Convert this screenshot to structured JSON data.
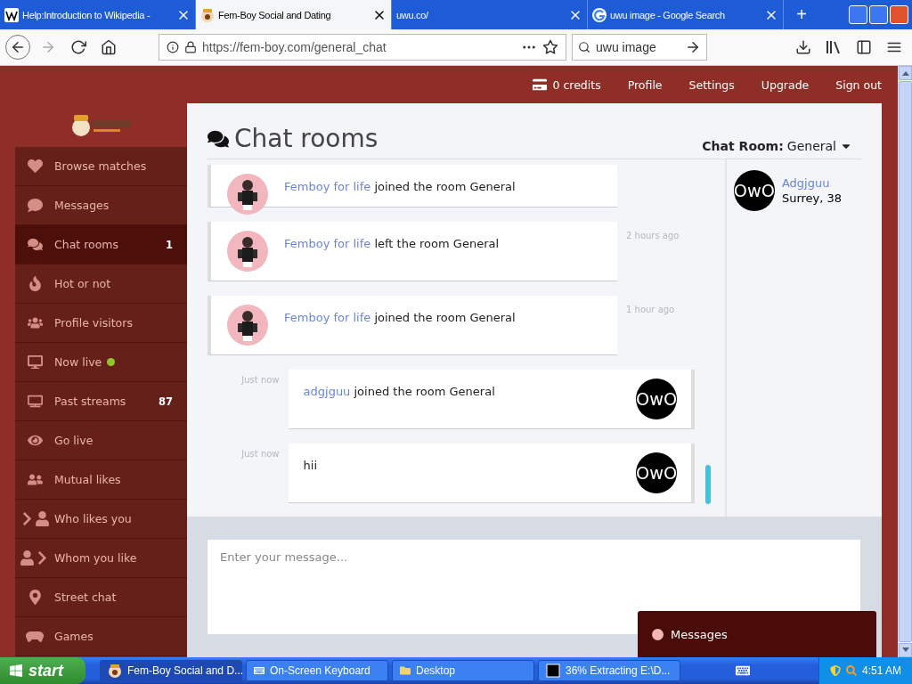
{
  "browser": {
    "tabs": [
      {
        "title": "Help:Introduction to Wikipedia -",
        "selected": false,
        "kind": "wiki"
      },
      {
        "title": "Fem-Boy Social and Dating",
        "selected": true,
        "kind": "site"
      },
      {
        "title": "uwu.co/",
        "selected": false,
        "kind": "plain"
      },
      {
        "title": "uwu image - Google Search",
        "selected": false,
        "kind": "google"
      }
    ],
    "new_tab": "+",
    "url": "https://fem-boy.com/general_chat",
    "search": "uwu image"
  },
  "top_links": [
    {
      "label": "0 credits",
      "kind": "credits"
    },
    {
      "label": "Profile",
      "kind": "link"
    },
    {
      "label": "Settings",
      "kind": "link"
    },
    {
      "label": "Upgrade",
      "kind": "link"
    },
    {
      "label": "Sign out",
      "kind": "link"
    }
  ],
  "sidebar": {
    "items": [
      {
        "label": "Browse matches",
        "selected": false
      },
      {
        "label": "Messages",
        "selected": false
      },
      {
        "label": "Chat rooms",
        "selected": true,
        "count": "1"
      },
      {
        "label": "Hot or not",
        "selected": false
      },
      {
        "label": "Profile visitors",
        "selected": false
      },
      {
        "label": "Now live",
        "selected": false,
        "live": true
      },
      {
        "label": "Past streams",
        "selected": false,
        "count": "87"
      },
      {
        "label": "Go live",
        "selected": false
      },
      {
        "label": "Mutual likes",
        "selected": false
      },
      {
        "label": "Who likes you",
        "selected": false
      },
      {
        "label": "Whom you like",
        "selected": false
      },
      {
        "label": "Street chat",
        "selected": false
      },
      {
        "label": "Games",
        "selected": false
      }
    ]
  },
  "chat": {
    "title": "Chat rooms",
    "room_label": "Chat Room:",
    "room": "General",
    "messages": [
      {
        "kind": "incoming",
        "user": "Femboy for life",
        "text": "joined the room General"
      },
      {
        "kind": "incoming",
        "user": "Femboy for life",
        "text": "left the room General",
        "time": "2 hours ago"
      },
      {
        "kind": "incoming",
        "user": "Femboy for life",
        "text": "joined the room General",
        "time": "1 hour ago"
      },
      {
        "kind": "outgoing",
        "user": "adgjguu",
        "text": "joined the room General",
        "time": "Just now",
        "avatar_text": "OwO"
      },
      {
        "kind": "outgoing",
        "text": "hii",
        "time": "Just now",
        "avatar_text": "OwO"
      }
    ],
    "users": [
      {
        "name": "Adgjguu",
        "info": "Surrey, 38",
        "avatar_text": "OwO"
      }
    ],
    "composer": {
      "placeholder": "Enter your message..."
    },
    "messages_popup": "Messages"
  },
  "taskbar": {
    "start": "start",
    "items": [
      {
        "label": "Fem-Boy Social and D...",
        "selected": true,
        "kind": "browser"
      },
      {
        "label": "On-Screen Keyboard",
        "selected": false,
        "kind": "keyboard"
      },
      {
        "label": "Desktop",
        "selected": false,
        "kind": "folder"
      },
      {
        "label": "36% Extracting E:\\D...",
        "selected": false,
        "kind": "archive"
      }
    ],
    "clock": "4:51 AM"
  }
}
